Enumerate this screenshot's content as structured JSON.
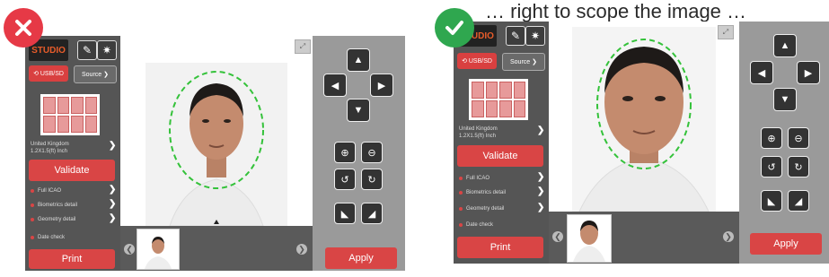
{
  "headline": "… right to scope the image …",
  "colors": {
    "bad": "#e63946",
    "good": "#2fa74f",
    "accent": "#d94545"
  },
  "icons": {
    "bad": "x-mark-icon",
    "good": "check-mark-icon",
    "pencil": "pencil-icon",
    "brightness": "brightness-icon",
    "usb": "usb-icon",
    "pan_up": "arrow-up-icon",
    "pan_left": "arrow-left-icon",
    "pan_right": "arrow-right-icon",
    "pan_down": "arrow-down-icon",
    "zoom_in": "zoom-in-icon",
    "zoom_out": "zoom-out-icon",
    "rotate_ccw": "rotate-left-icon",
    "rotate_cw": "rotate-right-icon",
    "tilt_left": "tilt-left-icon",
    "tilt_right": "tilt-right-icon"
  },
  "app": {
    "logo": "STUDIO",
    "usb_label": "USB/SD",
    "source_label": "Source",
    "country": "United Kingdom",
    "format": "1.2X1.5(ft) Inch",
    "validate_label": "Validate",
    "checks": [
      "Full ICAO",
      "Biometrics detail",
      "Geometry detail",
      "Date check"
    ],
    "print_label": "Print",
    "apply_label": "Apply"
  }
}
